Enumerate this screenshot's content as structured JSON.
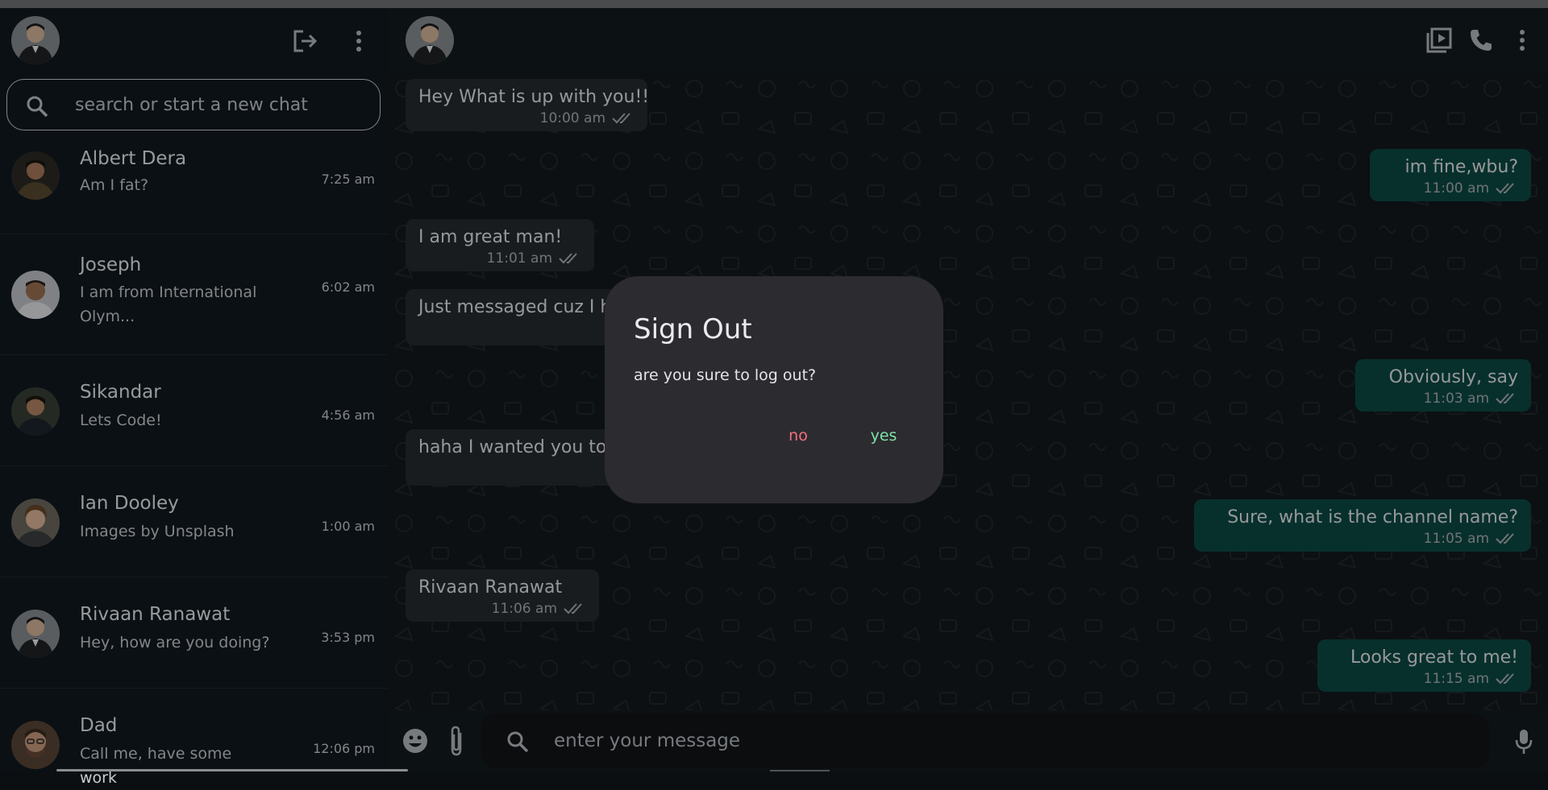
{
  "sidebar": {
    "search": {
      "placeholder": "search or start a new chat"
    },
    "chats": [
      {
        "name": "Albert Dera",
        "message": "Am I fat?",
        "time": "7:25 am"
      },
      {
        "name": "Joseph",
        "message": "I am from International Olym...",
        "time": "6:02 am"
      },
      {
        "name": "Sikandar",
        "message": "Lets Code!",
        "time": "4:56 am"
      },
      {
        "name": "Ian Dooley",
        "message": "Images by Unsplash",
        "time": "1:00 am"
      },
      {
        "name": "Rivaan Ranawat",
        "message": "Hey, how are you doing?",
        "time": "3:53 pm"
      },
      {
        "name": "Dad",
        "message": "Call me, have some work",
        "time": "12:06 pm"
      }
    ]
  },
  "conversation": {
    "messages": [
      {
        "direction": "in",
        "text": "Hey What is up with you!!",
        "time": "10:00 am"
      },
      {
        "direction": "out",
        "text": "im fine,wbu?",
        "time": "11:00 am"
      },
      {
        "direction": "in",
        "text": "I am great man!",
        "time": "11:01 am"
      },
      {
        "direction": "in",
        "text": "Just messaged cuz I h",
        "time": ""
      },
      {
        "direction": "out",
        "text": "Obviously, say",
        "time": "11:03 am"
      },
      {
        "direction": "in",
        "text": "haha I wanted you to",
        "time": ""
      },
      {
        "direction": "out",
        "text": "Sure, what is the channel name?",
        "time": "11:05 am"
      },
      {
        "direction": "in",
        "text": "Rivaan Ranawat",
        "time": "11:06 am"
      },
      {
        "direction": "out",
        "text": "Looks great to me!",
        "time": "11:15 am"
      }
    ]
  },
  "composer": {
    "placeholder": "enter your message"
  },
  "dialog": {
    "title": "Sign Out",
    "body": "are you sure to log out?",
    "no_label": "no",
    "yes_label": "yes"
  },
  "icons": {
    "logout": "logout-icon",
    "more": "more-vertical-icon",
    "search": "search-icon",
    "video": "video-library-icon",
    "call": "phone-icon",
    "emoji": "emoji-icon",
    "attach": "paperclip-icon",
    "mic": "microphone-icon",
    "read_receipt": "double-check-icon"
  },
  "colors": {
    "outgoing_bubble": "#0c4a45",
    "incoming_bubble": "#262b2e",
    "dialog_bg": "#2c2b30",
    "no_button": "#f2707a",
    "yes_button": "#7fe3a8"
  }
}
